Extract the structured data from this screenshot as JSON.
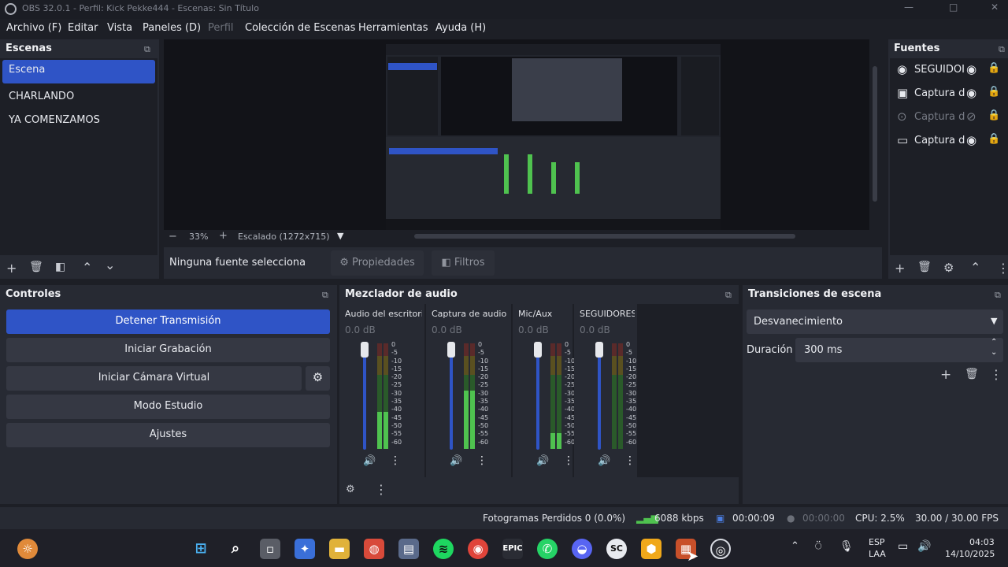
{
  "window": {
    "title": "OBS 32.0.1 - Perfil: Kick Pekke444 - Escenas: Sin Título",
    "minimize": "—",
    "maximize": "□",
    "close": "✕"
  },
  "menu": [
    "Archivo (F)",
    "Editar",
    "Vista",
    "Paneles (D)",
    "Perfil",
    "Colección de Escenas",
    "Herramientas",
    "Ayuda (H)"
  ],
  "scenes": {
    "title": "Escenas",
    "items": [
      "Escena",
      "CHARLANDO",
      "YA COMENZAMOS"
    ],
    "selected_index": 0
  },
  "preview": {
    "zoom": "33%",
    "scale_label": "Escalado (1272x715)",
    "zoom_minus": "−",
    "zoom_plus": "+"
  },
  "context_bar": {
    "no_source": "Ninguna fuente selecciona",
    "properties": "Propiedades",
    "filters": "Filtros"
  },
  "sources": {
    "title": "Fuentes",
    "items": [
      {
        "label": "SEGUIDOI",
        "icon": "browser-icon",
        "visible": true
      },
      {
        "label": "Captura d",
        "icon": "window-capture-icon",
        "visible": true
      },
      {
        "label": "Captura d",
        "icon": "game-capture-icon",
        "visible": false
      },
      {
        "label": "Captura d",
        "icon": "display-capture-icon",
        "visible": true
      }
    ]
  },
  "controls": {
    "title": "Controles",
    "stop_stream": "Detener Transmisión",
    "start_record": "Iniciar Grabación",
    "start_vcam": "Iniciar Cámara Virtual",
    "studio_mode": "Modo Estudio",
    "settings": "Ajustes"
  },
  "mixer": {
    "title": "Mezclador de audio",
    "scale": [
      "0",
      "-5",
      "-10",
      "-15",
      "-20",
      "-25",
      "-30",
      "-35",
      "-40",
      "-45",
      "-50",
      "-55",
      "-60"
    ],
    "channels": [
      {
        "name": "Audio del escritorio",
        "db": "0.0 dB",
        "level": 0.35
      },
      {
        "name": "Captura de audio d",
        "db": "0.0 dB",
        "level": 0.55
      },
      {
        "name": "Mic/Aux",
        "db": "0.0 dB",
        "level": 0.15
      },
      {
        "name": "SEGUIDORES",
        "db": "0.0 dB",
        "level": 0.0
      }
    ]
  },
  "transitions": {
    "title": "Transiciones de escena",
    "selected": "Desvanecimiento",
    "duration_label": "Duración",
    "duration_value": "300 ms"
  },
  "status": {
    "dropped_frames": "Fotogramas Perdidos 0 (0.0%)",
    "bitrate": "6088 kbps",
    "stream_time": "00:00:09",
    "record_time": "00:00:00",
    "cpu": "CPU: 2.5%",
    "fps": "30.00 / 30.00 FPS"
  },
  "taskbar": {
    "lang": "ESP",
    "lang2": "LAA",
    "time": "04:03",
    "date": "14/10/2025"
  },
  "colors": {
    "accent": "#2f54c6",
    "panel": "#272a33",
    "meter_green": "#4fc24f",
    "meter_yellow": "#c8b43a",
    "meter_red": "#c63a3a"
  }
}
